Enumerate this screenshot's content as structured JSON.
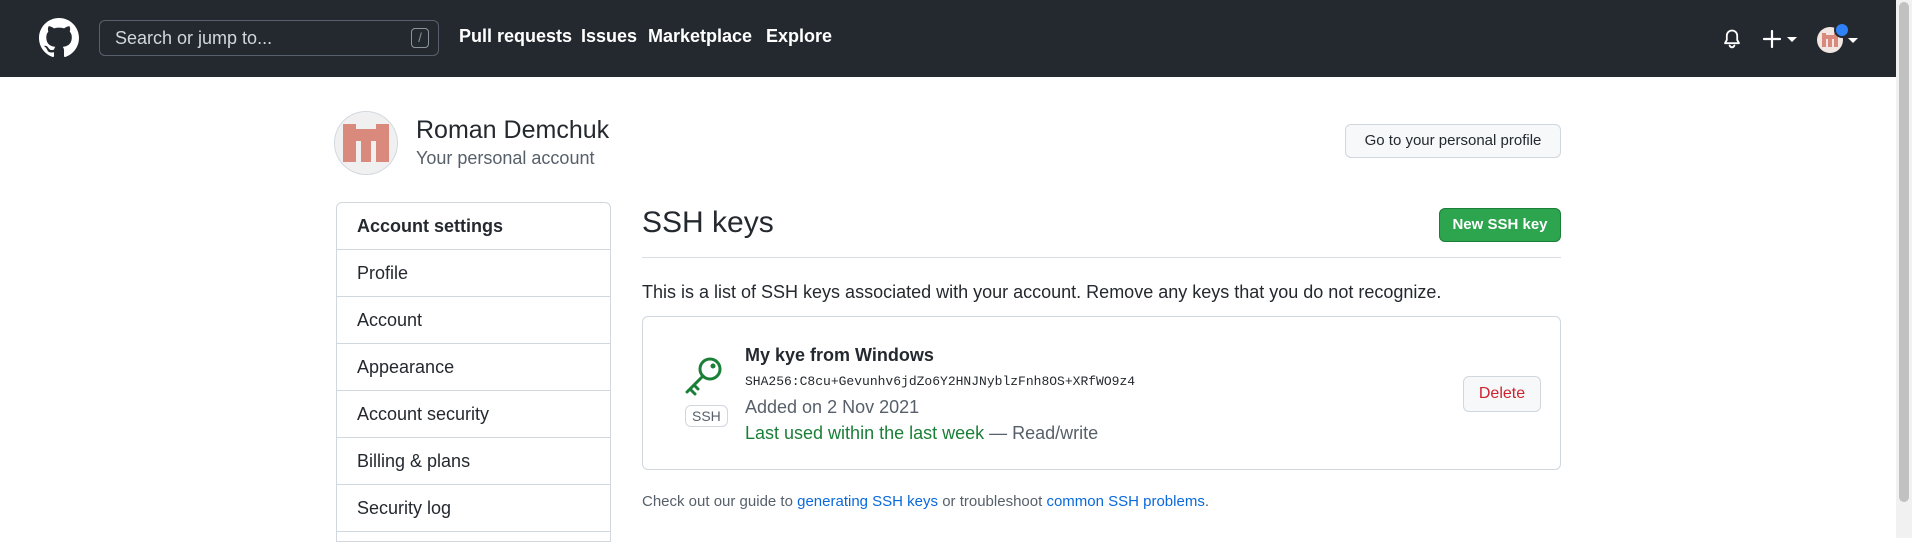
{
  "header": {
    "search": {
      "placeholder": "Search or jump to...",
      "shortcut": "/"
    },
    "nav": [
      {
        "label": "Pull requests"
      },
      {
        "label": "Issues"
      },
      {
        "label": "Marketplace"
      },
      {
        "label": "Explore"
      }
    ],
    "icons": [
      "github-logo",
      "bell-icon",
      "plus-icon",
      "avatar"
    ]
  },
  "profile": {
    "name": "Roman Demchuk",
    "subtitle": "Your personal account",
    "go_to_profile_label": "Go to your personal profile"
  },
  "sidebar": {
    "items": [
      {
        "label": "Account settings"
      },
      {
        "label": "Profile"
      },
      {
        "label": "Account"
      },
      {
        "label": "Appearance"
      },
      {
        "label": "Account security"
      },
      {
        "label": "Billing & plans"
      },
      {
        "label": "Security log"
      }
    ]
  },
  "main": {
    "title": "SSH keys",
    "new_key_label": "New SSH key",
    "description": "This is a list of SSH keys associated with your account. Remove any keys that you do not recognize.",
    "key": {
      "badge": "SSH",
      "name": "My kye from Windows",
      "fingerprint": "SHA256:C8cu+Gevunhv6jdZo6Y2HNJNyblzFnh8OS+XRfWO9z4",
      "added": "Added on 2 Nov 2021",
      "last_used": "Last used within the last week",
      "access": " — Read/write",
      "delete_label": "Delete"
    },
    "footer": {
      "prefix": "Check out our guide to ",
      "link1": "generating SSH keys",
      "middle": " or troubleshoot ",
      "link2": "common SSH problems",
      "suffix": "."
    }
  },
  "colors": {
    "header_bg": "#24292f",
    "primary_button": "#2da44e",
    "danger_text": "#cf222e",
    "link": "#0969da",
    "success_text": "#1a7f37",
    "notification_dot": "#2f81f7"
  }
}
